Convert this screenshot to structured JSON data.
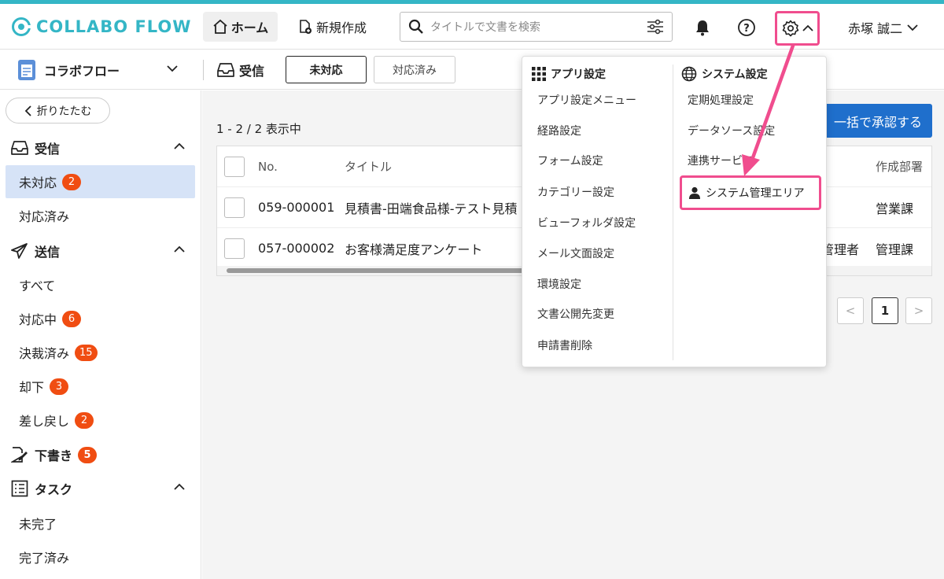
{
  "header": {
    "logo_text": "COLLABO FLOW",
    "home_label": "ホーム",
    "new_label": "新規作成",
    "search_placeholder": "タイトルで文書を検索",
    "user_name": "赤塚 誠二"
  },
  "subheader": {
    "app_name": "コラボフロー",
    "inbox_label": "受信",
    "tabs": [
      {
        "label": "未対応",
        "active": true
      },
      {
        "label": "対応済み",
        "active": false
      }
    ]
  },
  "sidebar": {
    "collapse_label": "折りたたむ",
    "sections": [
      {
        "label": "受信",
        "items": [
          {
            "label": "未対応",
            "badge": "2",
            "active": true
          },
          {
            "label": "対応済み",
            "badge": ""
          }
        ]
      },
      {
        "label": "送信",
        "items": [
          {
            "label": "すべて",
            "badge": ""
          },
          {
            "label": "対応中",
            "badge": "6"
          },
          {
            "label": "決裁済み",
            "badge": "15"
          },
          {
            "label": "却下",
            "badge": "3"
          },
          {
            "label": "差し戻し",
            "badge": "2"
          }
        ]
      },
      {
        "label": "下書き",
        "badge": "5"
      },
      {
        "label": "タスク",
        "items": [
          {
            "label": "未完了",
            "badge": ""
          },
          {
            "label": "完了済み",
            "badge": ""
          }
        ]
      }
    ]
  },
  "main": {
    "count_text": "1 - 2 / 2 表示中",
    "approve_label": "一括で承認する",
    "table": {
      "headers": {
        "no": "No.",
        "title": "タイトル",
        "dept": "作成部署"
      },
      "rows": [
        {
          "no": "059-000001",
          "title": "見積書-田端食品様-テスト見積",
          "admin": "",
          "dept": "営業課"
        },
        {
          "no": "057-000002",
          "title": "お客様満足度アンケート",
          "admin": "管理者",
          "dept": "管理課"
        }
      ]
    },
    "pager": {
      "prev": "<",
      "current": "1",
      "next": ">"
    }
  },
  "settings_menu": {
    "app_settings": {
      "heading": "アプリ設定",
      "items": [
        "アプリ設定メニュー",
        "経路設定",
        "フォーム設定",
        "カテゴリー設定",
        "ビューフォルダ設定",
        "メール文面設定",
        "環境設定",
        "文書公開先変更",
        "申請書削除"
      ]
    },
    "system_settings": {
      "heading": "システム設定",
      "items": [
        "定期処理設定",
        "データソース設定",
        "連携サービス"
      ],
      "highlight_item": "システム管理エリア"
    }
  },
  "colors": {
    "brand": "#34b6c6",
    "badge": "#f04d12",
    "primary_button": "#1f6fcc",
    "highlight": "#f04d8e",
    "active_item": "#d6e3f7"
  }
}
